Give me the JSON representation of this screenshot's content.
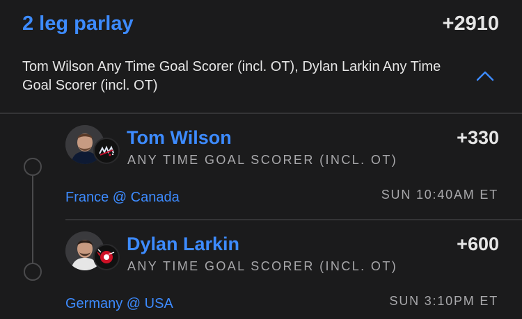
{
  "parlay": {
    "title": "2 leg parlay",
    "odds": "+2910",
    "description": "Tom Wilson Any Time Goal Scorer (incl. OT), Dylan Larkin Any Time Goal Scorer (incl. OT)",
    "collapse_icon": "chevron-up-icon"
  },
  "legs": [
    {
      "player": "Tom Wilson",
      "odds": "+330",
      "market": "ANY TIME GOAL SCORER (INCL. OT)",
      "match": "France @ Canada",
      "time": "SUN 10:40AM ET",
      "team_logo_icon": "capitals-logo-icon"
    },
    {
      "player": "Dylan Larkin",
      "odds": "+600",
      "market": "ANY TIME GOAL SCORER (INCL. OT)",
      "match": "Germany @ USA",
      "time": "SUN 3:10PM ET",
      "team_logo_icon": "red-wings-logo-icon"
    }
  ],
  "colors": {
    "background": "#1b1b1c",
    "accent": "#3d8bff",
    "text": "#e6e6e6",
    "muted": "#a8a8ab",
    "divider": "#343436"
  }
}
